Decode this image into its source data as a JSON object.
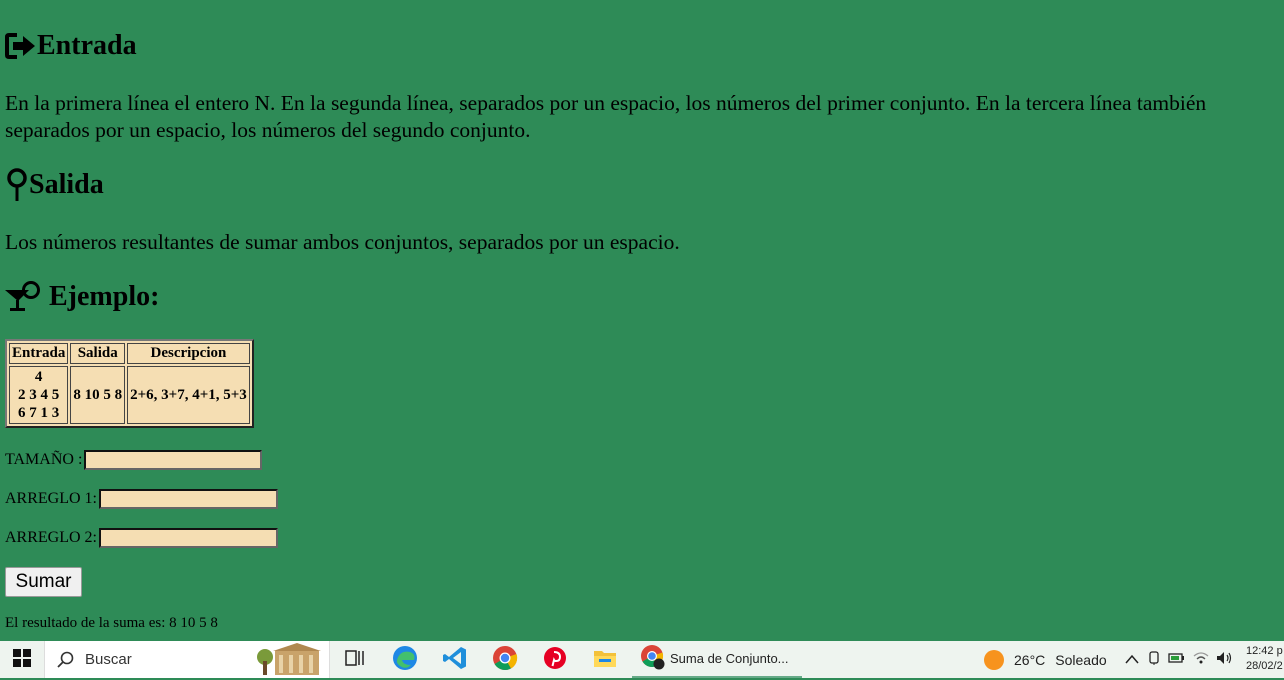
{
  "sections": {
    "entrada_title": "Entrada",
    "entrada_text": "En la primera línea el entero N. En la segunda línea, separados por un espacio, los números del primer conjunto. En la tercera línea también separados por un espacio, los números del segundo conjunto.",
    "salida_title": "Salida",
    "salida_text": "Los números resultantes de sumar ambos conjuntos, separados por un espacio.",
    "ejemplo_title": "Ejemplo:"
  },
  "example_table": {
    "headers": [
      "Entrada",
      "Salida",
      "Descripcion"
    ],
    "entrada_lines": [
      "4",
      "2 3 4 5",
      "6 7 1 3"
    ],
    "salida": "8 10 5 8",
    "descripcion": "2+6, 3+7, 4+1, 5+3"
  },
  "form": {
    "tamano_label": "TAMAÑO :",
    "tamano_value": "",
    "arreglo1_label": "ARREGLO 1:",
    "arreglo1_value": "",
    "arreglo2_label": "ARREGLO 2:",
    "arreglo2_value": "",
    "button_label": "Sumar",
    "result_text": "El resultado de la suma es: 8 10 5 8"
  },
  "taskbar": {
    "search_placeholder": "Buscar",
    "active_window": "Suma de Conjunto...",
    "temperature": "26°C",
    "weather": "Soleado",
    "time": "12:42 p",
    "date": "28/02/2"
  },
  "colors": {
    "page_background": "#2e8b57",
    "input_background": "#f5deb3"
  }
}
